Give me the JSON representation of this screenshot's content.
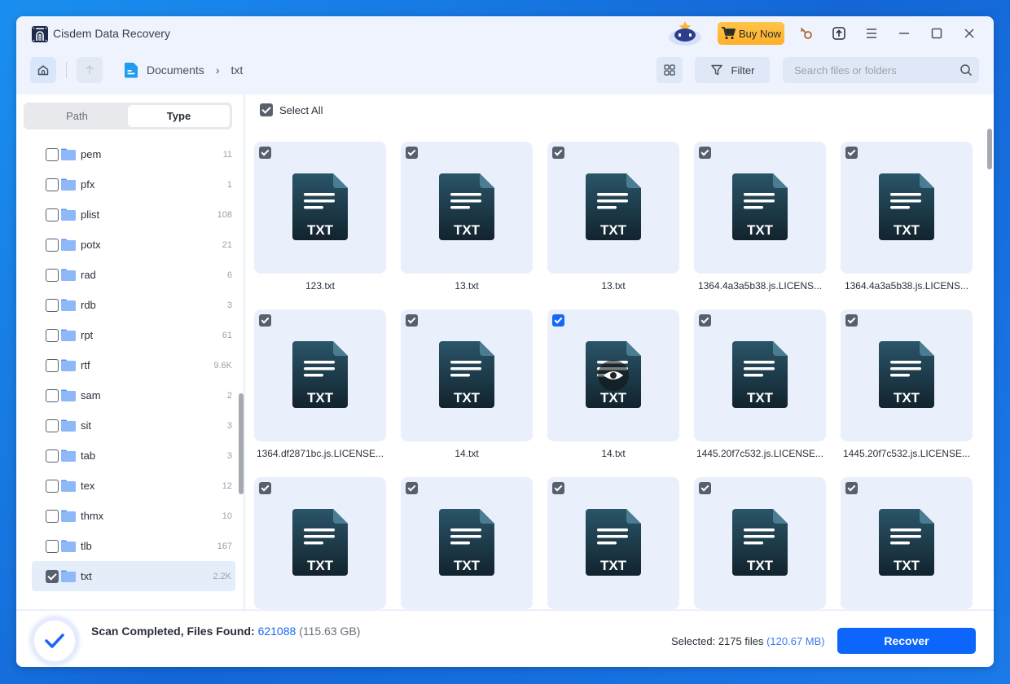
{
  "app": {
    "title": "Cisdem Data Recovery",
    "buy_label": "Buy Now"
  },
  "toolbar": {
    "breadcrumb": [
      "Documents",
      "txt"
    ],
    "filter_label": "Filter",
    "search_placeholder": "Search files or folders",
    "search_value": ""
  },
  "left_panel": {
    "tabs": [
      {
        "label": "Path",
        "active": false
      },
      {
        "label": "Type",
        "active": true
      }
    ],
    "types": [
      {
        "name": "pem",
        "count": "11",
        "checked": false
      },
      {
        "name": "pfx",
        "count": "1",
        "checked": false
      },
      {
        "name": "plist",
        "count": "108",
        "checked": false
      },
      {
        "name": "potx",
        "count": "21",
        "checked": false
      },
      {
        "name": "rad",
        "count": "6",
        "checked": false
      },
      {
        "name": "rdb",
        "count": "3",
        "checked": false
      },
      {
        "name": "rpt",
        "count": "61",
        "checked": false
      },
      {
        "name": "rtf",
        "count": "9.6K",
        "checked": false
      },
      {
        "name": "sam",
        "count": "2",
        "checked": false
      },
      {
        "name": "sit",
        "count": "3",
        "checked": false
      },
      {
        "name": "tab",
        "count": "3",
        "checked": false
      },
      {
        "name": "tex",
        "count": "12",
        "checked": false
      },
      {
        "name": "thmx",
        "count": "10",
        "checked": false
      },
      {
        "name": "tlb",
        "count": "167",
        "checked": false
      },
      {
        "name": "txt",
        "count": "2.2K",
        "checked": true
      }
    ]
  },
  "main": {
    "select_all_label": "Select All",
    "file_badge": "TXT",
    "files": [
      {
        "name": "123.txt",
        "checked": true
      },
      {
        "name": "13.txt",
        "checked": true
      },
      {
        "name": "13.txt",
        "checked": true
      },
      {
        "name": "1364.4a3a5b38.js.LICENS...",
        "checked": true
      },
      {
        "name": "1364.4a3a5b38.js.LICENS...",
        "checked": true
      },
      {
        "name": "1364.df2871bc.js.LICENSE...",
        "checked": true
      },
      {
        "name": "14.txt",
        "checked": true
      },
      {
        "name": "14.txt",
        "checked": true,
        "hovered": true
      },
      {
        "name": "1445.20f7c532.js.LICENSE...",
        "checked": true
      },
      {
        "name": "1445.20f7c532.js.LICENSE...",
        "checked": true
      },
      {
        "name": "",
        "checked": true
      },
      {
        "name": "",
        "checked": true
      },
      {
        "name": "",
        "checked": true
      },
      {
        "name": "",
        "checked": true
      },
      {
        "name": "",
        "checked": true
      }
    ]
  },
  "status": {
    "scan_label": "Scan Completed, Files Found: ",
    "files_found": "621088",
    "total_size": "(115.63 GB)",
    "selected_label": "Selected: 2175 files ",
    "selected_size": "(120.67 MB)",
    "recover_label": "Recover"
  },
  "colors": {
    "accent": "#0d66fb",
    "buy": "#ffb52e",
    "tile_bg": "#eaf0fb"
  }
}
